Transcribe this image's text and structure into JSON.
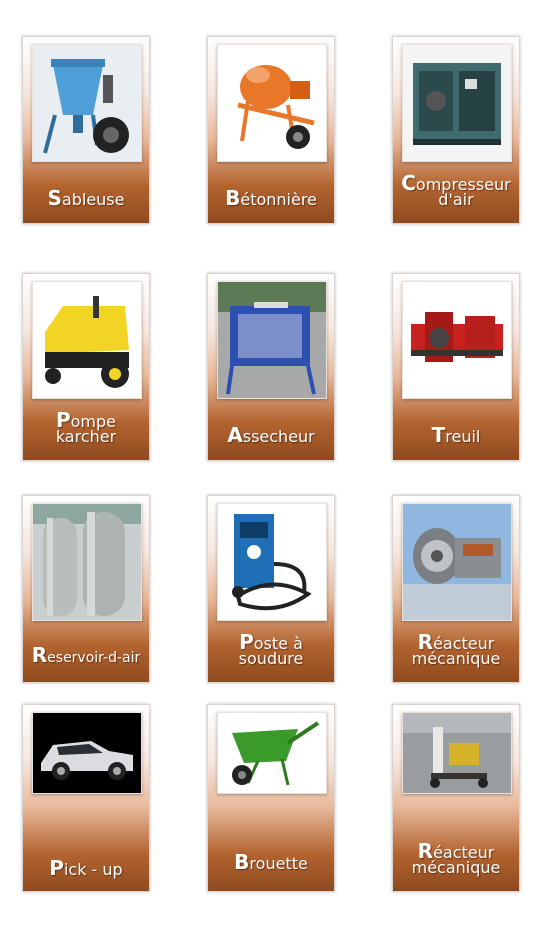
{
  "items": [
    {
      "first": "S",
      "rest": "ableuse",
      "line2": "",
      "img": "sandblaster-image"
    },
    {
      "first": "B",
      "rest": "étonnière",
      "line2": "",
      "img": "concrete-mixer-image"
    },
    {
      "first": "C",
      "rest": "ompresseur",
      "line2": "d'air",
      "img": "air-compressor-image"
    },
    {
      "first": "P",
      "rest": "ompe",
      "line2": "karcher",
      "img": "pressure-washer-image"
    },
    {
      "first": "A",
      "rest": "ssecheur",
      "line2": "",
      "img": "dryer-image"
    },
    {
      "first": "T",
      "rest": "reuil",
      "line2": "",
      "img": "winch-image"
    },
    {
      "first": "R",
      "rest": "eservoir-d-air",
      "line2": "",
      "img": "air-tank-image"
    },
    {
      "first": "P",
      "rest": "oste à",
      "line2": "soudure",
      "img": "welding-station-image"
    },
    {
      "first": "R",
      "rest": "éacteur",
      "line2": "mécanique",
      "img": "jet-engine-image"
    },
    {
      "first": "P",
      "rest": "ick - up",
      "line2": "",
      "img": "pickup-truck-image"
    },
    {
      "first": "B",
      "rest": "rouette",
      "line2": "",
      "img": "wheelbarrow-image"
    },
    {
      "first": "R",
      "rest": "éacteur",
      "line2": "mécanique",
      "img": "engine-stand-image"
    }
  ]
}
